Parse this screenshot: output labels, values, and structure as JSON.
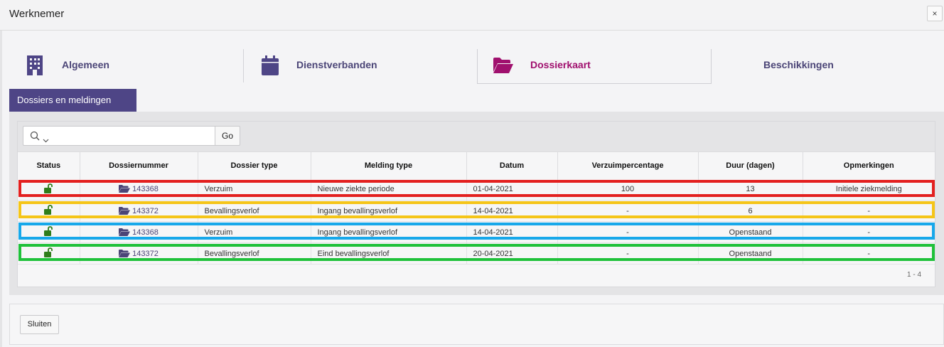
{
  "dialog": {
    "title": "Werknemer",
    "close_symbol": "×"
  },
  "tabs": [
    {
      "label": "Algemeen",
      "icon": "building-icon"
    },
    {
      "label": "Dienstverbanden",
      "icon": "calendar-icon"
    },
    {
      "label": "Dossierkaart",
      "icon": "folder-open-icon",
      "active": true
    },
    {
      "label": "Beschikkingen",
      "icon": ""
    }
  ],
  "subtab": {
    "label": "Dossiers en meldingen"
  },
  "search": {
    "value": "",
    "placeholder": "",
    "go_label": "Go"
  },
  "table": {
    "columns": [
      "Status",
      "Dossiernummer",
      "Dossier type",
      "Melding type",
      "Datum",
      "Verzuimpercentage",
      "Duur (dagen)",
      "Opmerkingen"
    ],
    "rows": [
      {
        "status": "unlocked-icon",
        "dossiernummer": "143368",
        "dossier_type": "Verzuim",
        "melding_type": "Nieuwe ziekte periode",
        "datum": "01-04-2021",
        "verzuimpercentage": "100",
        "duur": "13",
        "opmerkingen": "Initiele ziekmelding",
        "highlight": "#e3201f"
      },
      {
        "status": "unlocked-icon",
        "dossiernummer": "143372",
        "dossier_type": "Bevallingsverlof",
        "melding_type": "Ingang bevallingsverlof",
        "datum": "14-04-2021",
        "verzuimpercentage": "-",
        "duur": "6",
        "opmerkingen": "-",
        "highlight": "#f5c518"
      },
      {
        "status": "unlocked-icon",
        "dossiernummer": "143368",
        "dossier_type": "Verzuim",
        "melding_type": "Ingang bevallingsverlof",
        "datum": "14-04-2021",
        "verzuimpercentage": "-",
        "duur": "Openstaand",
        "opmerkingen": "-",
        "highlight": "#17a8ea"
      },
      {
        "status": "unlocked-icon",
        "dossiernummer": "143372",
        "dossier_type": "Bevallingsverlof",
        "melding_type": "Eind bevallingsverlof",
        "datum": "20-04-2021",
        "verzuimpercentage": "-",
        "duur": "Openstaand",
        "opmerkingen": "-",
        "highlight": "#1fc13a"
      }
    ],
    "pagination": "1 - 4"
  },
  "footer": {
    "close_label": "Sluiten"
  },
  "colors": {
    "accent": "#4e4586",
    "active_tab": "#a0106e",
    "lock_green": "#2e7d1a"
  }
}
